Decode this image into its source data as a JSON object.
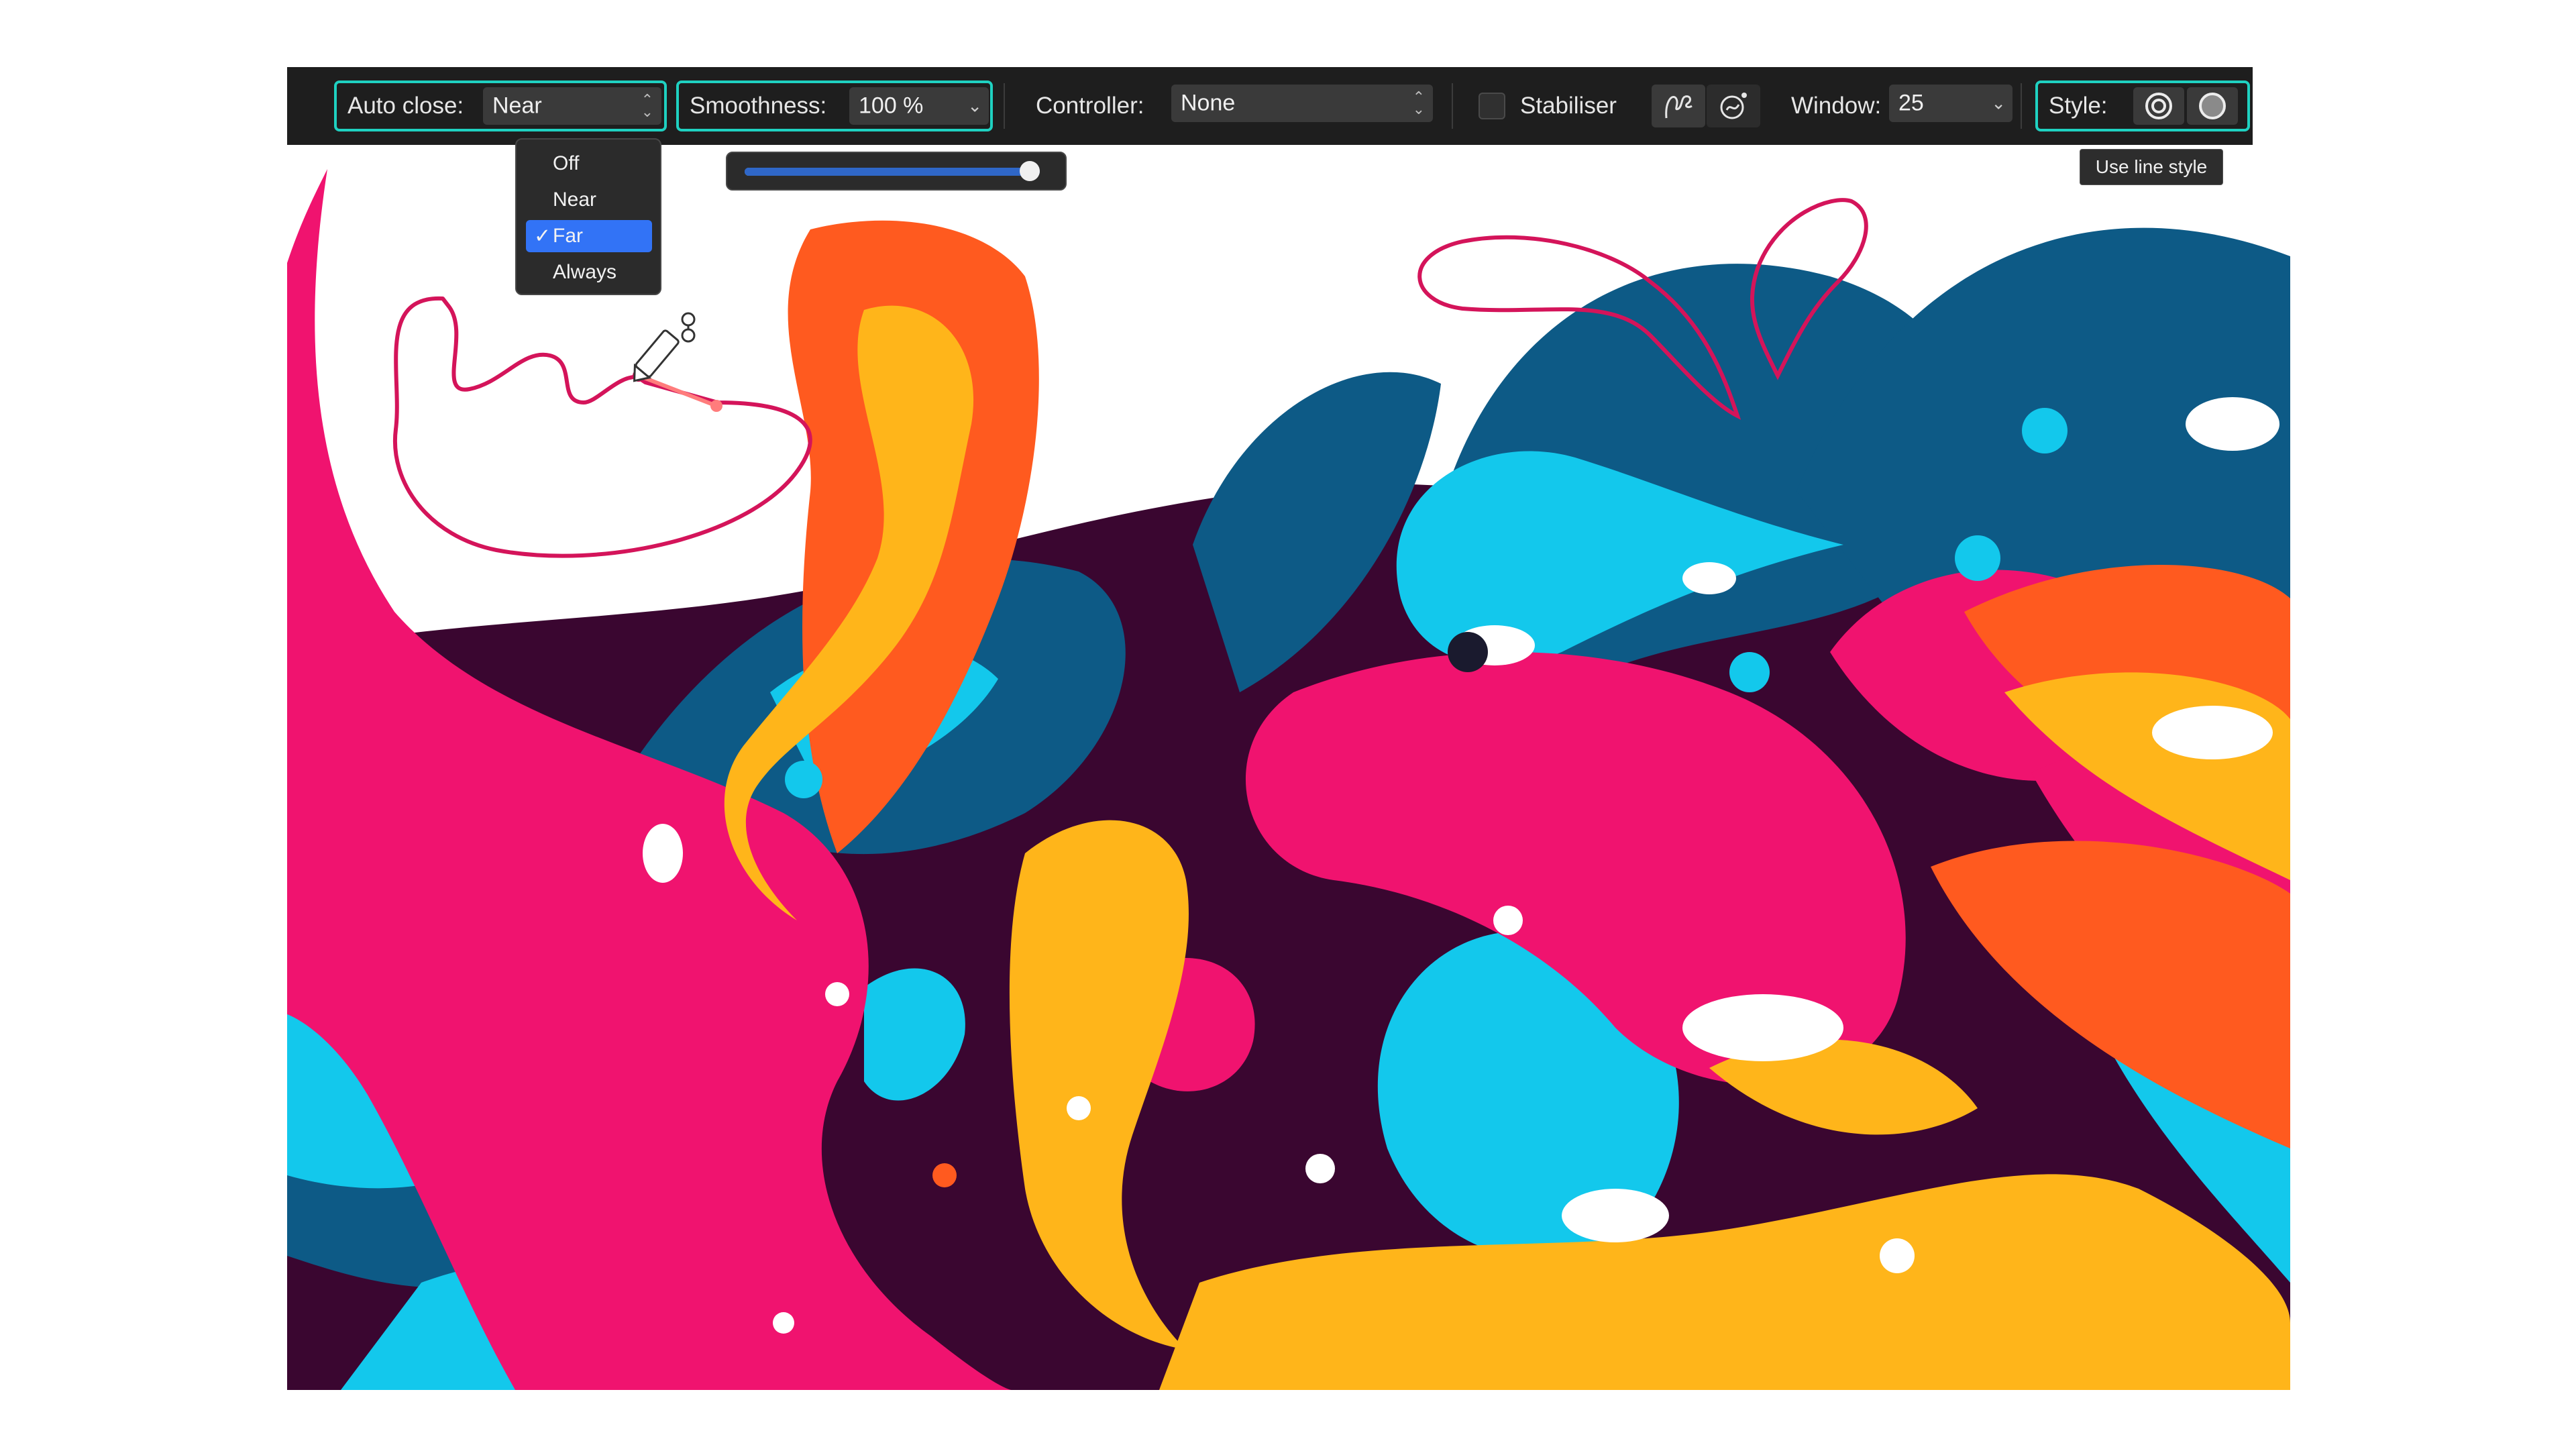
{
  "toolbar": {
    "auto_close": {
      "label": "Auto close:",
      "value": "Near"
    },
    "smoothness": {
      "label": "Smoothness:",
      "value": "100 %"
    },
    "controller": {
      "label": "Controller:",
      "value": "None"
    },
    "stabiliser": {
      "label": "Stabiliser",
      "checked": false
    },
    "window": {
      "label": "Window:",
      "value": "25"
    },
    "style": {
      "label": "Style:"
    }
  },
  "auto_close_menu": {
    "options": [
      "Off",
      "Near",
      "Far",
      "Always"
    ],
    "selected": "Far",
    "check_glyph": "✓"
  },
  "smoothness_slider": {
    "value_percent": 100
  },
  "tooltip": {
    "text": "Use line style"
  },
  "colors": {
    "highlight": "#1fd1c1",
    "stroke": "#d4145a",
    "menu_selected": "#3273f6",
    "art_navy": "#0d5a86",
    "art_cyan": "#13c8ec",
    "art_magenta": "#f0136f",
    "art_orange": "#ff5a1f",
    "art_yellow": "#ffb51a",
    "art_plum": "#3a0630"
  },
  "icons": [
    "chevron-updown-icon",
    "chevron-down-icon",
    "rope-stabiliser-icon",
    "window-stabiliser-icon",
    "line-style-icon",
    "fill-style-icon",
    "pencil-cursor-icon"
  ]
}
